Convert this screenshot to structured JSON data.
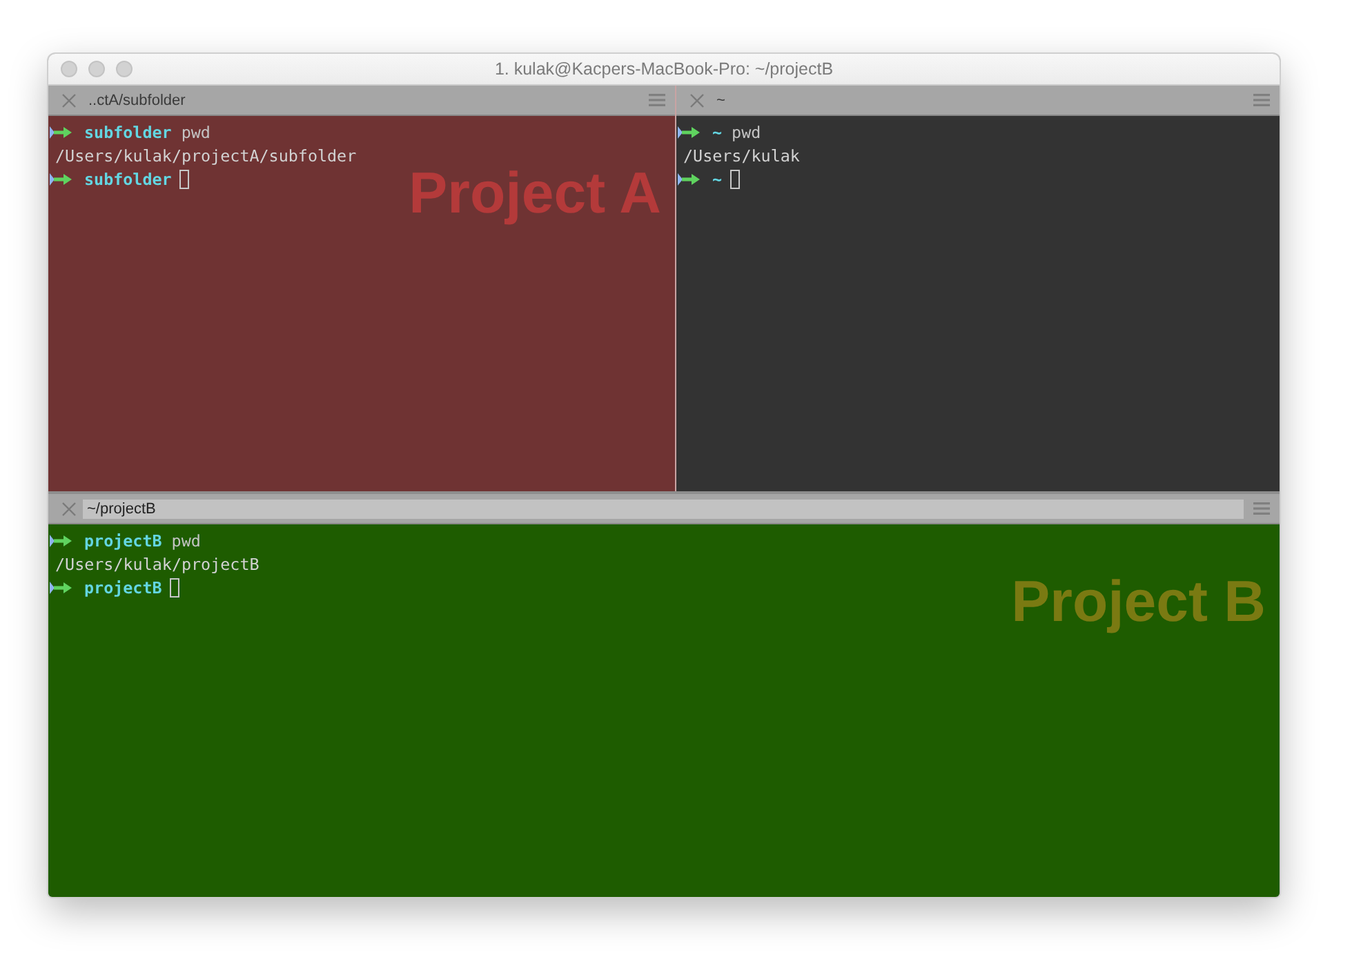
{
  "window": {
    "title": "1. kulak@Kacpers-MacBook-Pro: ~/projectB"
  },
  "rows": [
    {
      "panes": [
        {
          "title": "..ctA/subfolder",
          "active": false,
          "color": "#6f3333",
          "badge": {
            "text": "Project A",
            "color": "#b43a3a"
          },
          "lines": [
            {
              "kind": "prompt",
              "dir": "subfolder",
              "command": "pwd",
              "cursor": false
            },
            {
              "kind": "output",
              "text": "/Users/kulak/projectA/subfolder",
              "cursor": false
            },
            {
              "kind": "prompt",
              "dir": "subfolder",
              "cursor": true
            }
          ]
        },
        {
          "title": "~",
          "active": false,
          "color": "#333333",
          "lines": [
            {
              "kind": "prompt",
              "dir": "~",
              "command": "pwd",
              "cursor": false
            },
            {
              "kind": "output",
              "text": "/Users/kulak",
              "cursor": false
            },
            {
              "kind": "prompt",
              "dir": "~",
              "cursor": true
            }
          ]
        }
      ]
    },
    {
      "panes": [
        {
          "title": "~/projectB",
          "active": true,
          "color": "#1e5c00",
          "badge": {
            "text": "Project B",
            "color": "#7a7a12"
          },
          "lines": [
            {
              "kind": "prompt",
              "dir": "projectB",
              "command": "pwd",
              "cursor": false
            },
            {
              "kind": "output",
              "text": "/Users/kulak/projectB",
              "cursor": false
            },
            {
              "kind": "prompt",
              "dir": "projectB",
              "cursor": true
            }
          ]
        }
      ]
    }
  ]
}
